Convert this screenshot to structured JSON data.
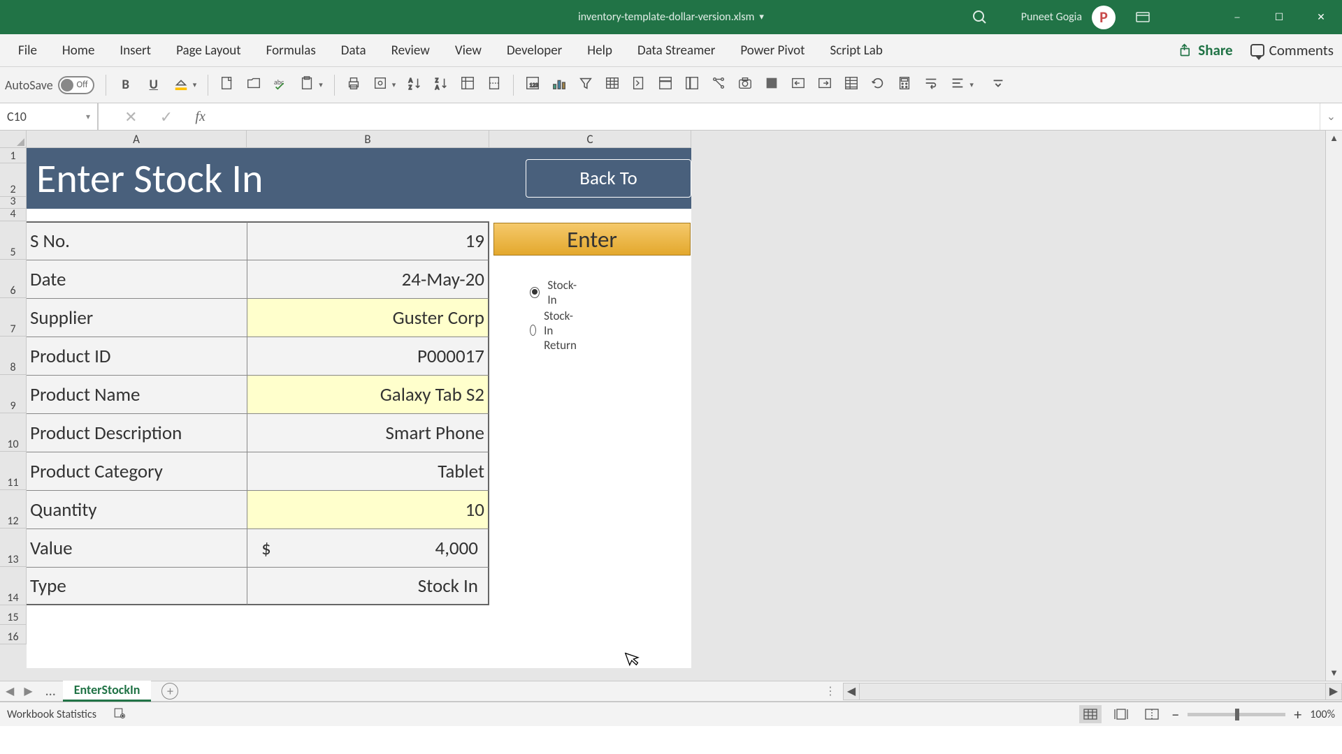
{
  "app": {
    "file_name": "inventory-template-dollar-version.xlsm",
    "user_name": "Puneet Gogia",
    "avatar_initial": "P"
  },
  "ribbon": {
    "tabs": [
      "File",
      "Home",
      "Insert",
      "Page Layout",
      "Formulas",
      "Data",
      "Review",
      "View",
      "Developer",
      "Help",
      "Data Streamer",
      "Power Pivot",
      "Script Lab"
    ],
    "share_label": "Share",
    "comments_label": "Comments"
  },
  "qat": {
    "autosave_label": "AutoSave",
    "autosave_toggle_text": "Off",
    "bold_label": "B",
    "underline_label": "U"
  },
  "formula_bar": {
    "name_box_value": "C10"
  },
  "grid": {
    "columns": {
      "A": "A",
      "B": "B",
      "C": "C"
    },
    "rows": [
      "1",
      "2",
      "3",
      "4",
      "5",
      "6",
      "7",
      "8",
      "9",
      "10",
      "11",
      "12",
      "13",
      "14",
      "15",
      "16"
    ]
  },
  "sheet_content": {
    "title": "Enter Stock In",
    "back_button": "Back To",
    "enter_button": "Enter",
    "radio_options": {
      "stock_in": "Stock-In",
      "stock_in_return": "Stock-In Return"
    },
    "selected_radio": "stock_in",
    "table_rows": [
      {
        "label": "S No.",
        "value": "19",
        "yellow": false
      },
      {
        "label": "Date",
        "value": "24-May-20",
        "yellow": false
      },
      {
        "label": "Supplier",
        "value": "Guster Corp",
        "yellow": true
      },
      {
        "label": "Product ID",
        "value": "P000017",
        "yellow": false
      },
      {
        "label": "Product Name",
        "value": "Galaxy Tab S2",
        "yellow": true
      },
      {
        "label": "Product Description",
        "value": "Smart Phone",
        "yellow": false
      },
      {
        "label": "Product Category",
        "value": "Tablet",
        "yellow": false
      },
      {
        "label": "Quantity",
        "value": "10",
        "yellow": true
      },
      {
        "label": "Value",
        "value": "4,000",
        "currency": "$",
        "yellow": false
      },
      {
        "label": "Type",
        "value": "Stock In",
        "yellow": false
      }
    ]
  },
  "sheet_tabs": {
    "active_tab": "EnterStockIn"
  },
  "status_bar": {
    "workbook_stats_label": "Workbook Statistics",
    "zoom_label": "100%"
  },
  "chart_data": {
    "type": "table",
    "title": "Enter Stock In",
    "rows": [
      {
        "S No.": 19
      },
      {
        "Date": "24-May-20"
      },
      {
        "Supplier": "Guster Corp"
      },
      {
        "Product ID": "P000017"
      },
      {
        "Product Name": "Galaxy Tab S2"
      },
      {
        "Product Description": "Smart Phone"
      },
      {
        "Product Category": "Tablet"
      },
      {
        "Quantity": 10
      },
      {
        "Value": 4000,
        "currency": "$"
      },
      {
        "Type": "Stock In"
      }
    ]
  }
}
